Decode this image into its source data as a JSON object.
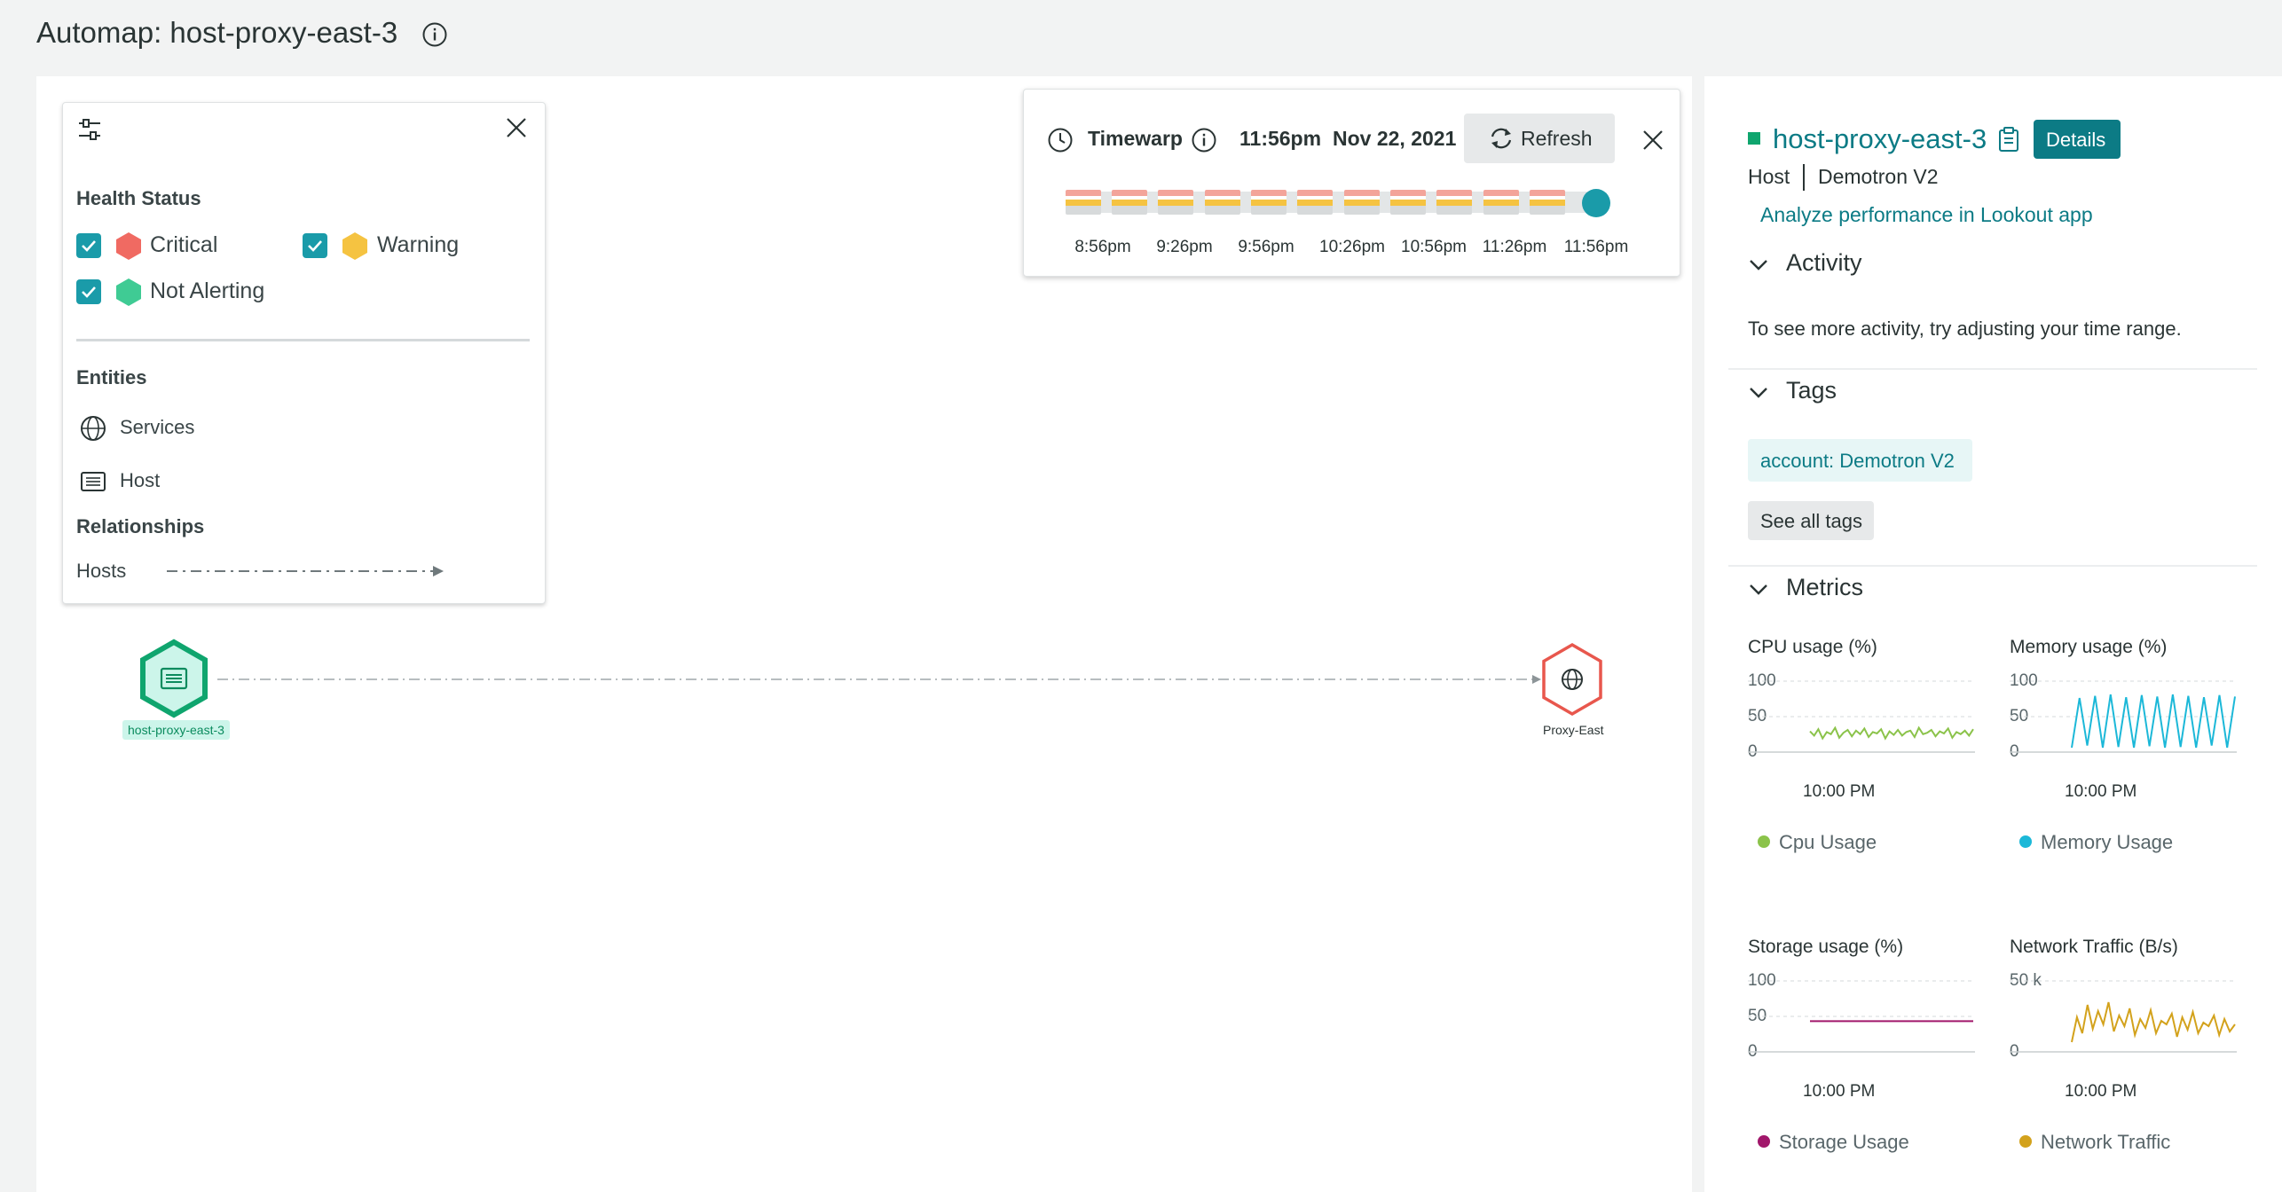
{
  "header": {
    "title": "Automap: host-proxy-east-3"
  },
  "legend": {
    "health_status_heading": "Health Status",
    "health_items": [
      {
        "label": "Critical",
        "color": "#f06a62",
        "checked": true
      },
      {
        "label": "Warning",
        "color": "#f5c341",
        "checked": true
      },
      {
        "label": "Not Alerting",
        "color": "#3fcb94",
        "checked": true
      }
    ],
    "entities_heading": "Entities",
    "entities": [
      {
        "label": "Services",
        "icon": "globe-icon"
      },
      {
        "label": "Host",
        "icon": "server-icon"
      }
    ],
    "relationships_heading": "Relationships",
    "relationships": [
      {
        "label": "Hosts"
      }
    ]
  },
  "timewarp": {
    "label": "Timewarp",
    "time": "11:56pm",
    "date": "Nov 22, 2021",
    "refresh_label": "Refresh",
    "ticks": [
      "8:56pm",
      "9:26pm",
      "9:56pm",
      "10:26pm",
      "10:56pm",
      "11:26pm",
      "11:56pm"
    ]
  },
  "map": {
    "nodes": [
      {
        "label": "host-proxy-east-3",
        "type": "host",
        "status": "not-alerting",
        "color": "#0fa56e"
      },
      {
        "label": "Proxy-East",
        "type": "service",
        "status": "critical",
        "color": "#e8574d"
      }
    ]
  },
  "entity_panel": {
    "name": "host-proxy-east-3",
    "details_label": "Details",
    "type": "Host",
    "account": "Demotron V2",
    "lookout_link": "Analyze performance in Lookout app",
    "activity_title": "Activity",
    "activity_text": "To see more activity, try adjusting your time range.",
    "tags_title": "Tags",
    "tags": [
      "account: Demotron V2"
    ],
    "see_all_tags_label": "See all tags",
    "metrics_title": "Metrics",
    "accent_color": "#0c7b85"
  },
  "chart_data": [
    {
      "type": "line",
      "title": "CPU usage (%)",
      "y_ticks": [
        "100",
        "50",
        "0"
      ],
      "x_label": "10:00 PM",
      "ylim": [
        0,
        100
      ],
      "series": [
        {
          "name": "Cpu Usage",
          "color": "#8bc34a",
          "values": [
            28,
            22,
            31,
            18,
            27,
            24,
            33,
            19,
            26,
            30,
            21,
            29,
            24,
            32,
            20,
            27,
            25,
            31,
            18,
            28,
            23,
            30,
            22,
            27,
            29,
            20,
            33,
            24,
            26,
            30,
            21,
            28,
            25,
            32,
            19,
            27,
            24,
            29,
            22,
            31
          ]
        }
      ]
    },
    {
      "type": "line",
      "title": "Memory usage (%)",
      "y_ticks": [
        "100",
        "50",
        "0"
      ],
      "x_label": "10:00 PM",
      "ylim": [
        0,
        100
      ],
      "series": [
        {
          "name": "Memory Usage",
          "color": "#1cb8d8",
          "values": [
            5,
            75,
            8,
            78,
            5,
            80,
            6,
            76,
            5,
            79,
            7,
            77,
            5,
            80,
            6,
            78,
            5,
            76,
            8,
            79,
            5,
            77
          ]
        }
      ]
    },
    {
      "type": "line",
      "title": "Storage usage (%)",
      "y_ticks": [
        "100",
        "50",
        "0"
      ],
      "x_label": "10:00 PM",
      "ylim": [
        0,
        100
      ],
      "series": [
        {
          "name": "Storage Usage",
          "color": "#a1176b",
          "values": [
            42,
            42,
            42,
            42,
            42,
            42,
            42,
            42,
            42,
            42
          ]
        }
      ]
    },
    {
      "type": "line",
      "title": "Network Traffic (B/s)",
      "y_ticks": [
        "50 k",
        "0"
      ],
      "x_label": "10:00 PM",
      "ylim": [
        0,
        80000
      ],
      "series": [
        {
          "name": "Network Traffic",
          "color": "#d3a21c",
          "values": [
            10000,
            38000,
            20000,
            52000,
            25000,
            45000,
            30000,
            55000,
            22000,
            40000,
            28000,
            48000,
            18000,
            36000,
            26000,
            46000,
            20000,
            34000,
            30000,
            42000,
            16000,
            38000,
            24000,
            44000,
            20000,
            32000,
            28000,
            40000,
            18000,
            36000,
            22000,
            30000
          ]
        }
      ]
    }
  ]
}
